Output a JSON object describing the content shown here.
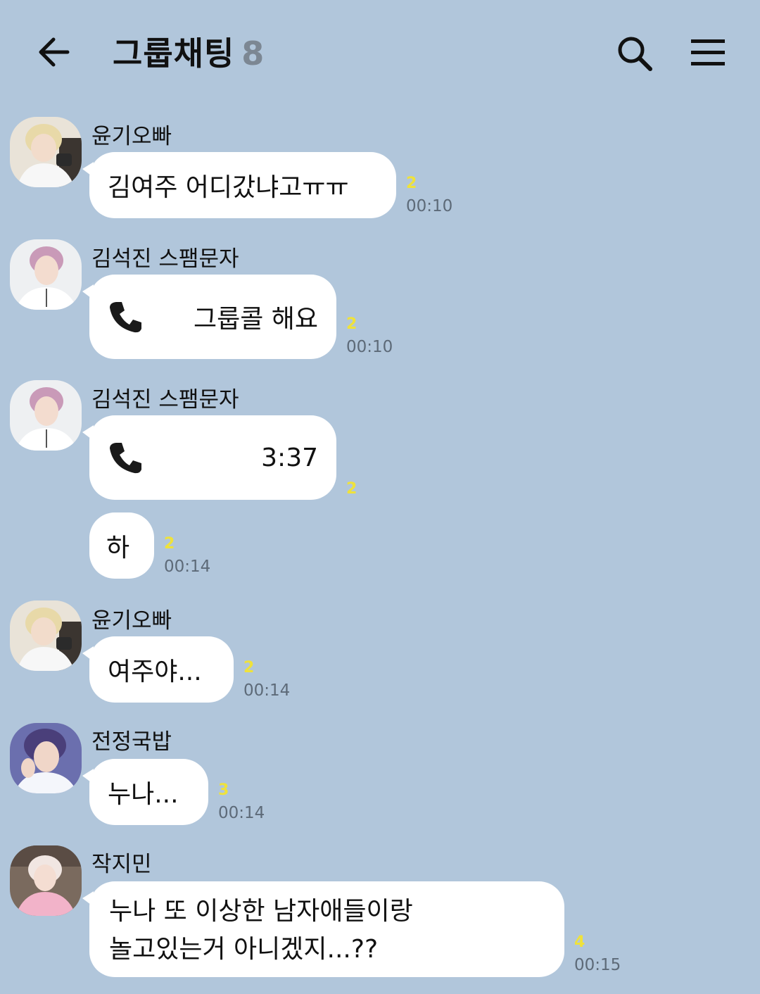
{
  "header": {
    "title": "그룹채팅",
    "member_count": "8"
  },
  "messages": [
    {
      "sender": "윤기오빠",
      "text": "김여주 어디갔냐고ㅠㅠ",
      "unread": "2",
      "time": "00:10"
    },
    {
      "sender": "김석진 스팸문자",
      "text": "그룹콜 해요",
      "unread": "2",
      "time": "00:10",
      "icon": "phone-icon"
    },
    {
      "sender": "김석진 스팸문자",
      "text": "3:37",
      "unread": "2",
      "icon": "phone-icon"
    },
    {
      "text": "하",
      "unread": "2",
      "time": "00:14"
    },
    {
      "sender": "윤기오빠",
      "text": "여주야...",
      "unread": "2",
      "time": "00:14"
    },
    {
      "sender": "전정국밥",
      "text": "누나...",
      "unread": "3",
      "time": "00:14"
    },
    {
      "sender": "작지민",
      "text_line1": "누나 또 이상한 남자애들이랑",
      "text_line2": "놀고있는거 아니겠지...??",
      "unread": "4",
      "time": "00:15"
    }
  ],
  "colors": {
    "background": "#b1c6db",
    "bubble": "#ffffff",
    "unread": "#efe23b",
    "time": "#5d6a78"
  }
}
